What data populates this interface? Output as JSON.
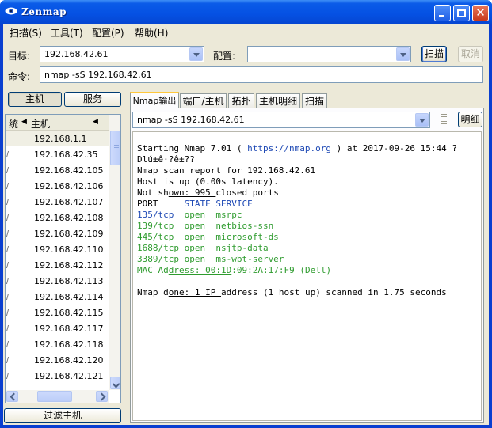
{
  "window": {
    "title": "Zenmap"
  },
  "menu": [
    {
      "label": "扫描(S)"
    },
    {
      "label": "工具(T)"
    },
    {
      "label": "配置(P)"
    },
    {
      "label": "帮助(H)"
    }
  ],
  "toolbar": {
    "target_label": "目标:",
    "target_value": "192.168.42.61",
    "profile_label": "配置:",
    "profile_value": "",
    "scan_button": "扫描",
    "cancel_button": "取消",
    "command_label": "命令:",
    "command_value": "nmap -sS 192.168.42.61"
  },
  "left_pane": {
    "hosts_button": "主机",
    "services_button": "服务",
    "col_os": "统",
    "col_host": "主机",
    "hosts": [
      "192.168.1.1",
      "192.168.42.35",
      "192.168.42.105",
      "192.168.42.106",
      "192.168.42.107",
      "192.168.42.108",
      "192.168.42.109",
      "192.168.42.110",
      "192.168.42.112",
      "192.168.42.113",
      "192.168.42.114",
      "192.168.42.115",
      "192.168.42.117",
      "192.168.42.118",
      "192.168.42.120",
      "192.168.42.121"
    ],
    "filter_button": "过滤主机"
  },
  "tabs": [
    {
      "label": "Nmap输出"
    },
    {
      "label": "端口/主机"
    },
    {
      "label": "拓扑"
    },
    {
      "label": "主机明细"
    },
    {
      "label": "扫描"
    }
  ],
  "output": {
    "command_value": "nmap -sS 192.168.42.61",
    "details_button": "明细",
    "lines": {
      "l1_a": "Starting Nmap 7.01 ( ",
      "l1_url": "https://nmap.org",
      "l1_b": " ) at 2017-09-26 15:44 ?",
      "l2": "Dlú±ê·?ê±??",
      "l3": "Nmap scan report for 192.168.42.61",
      "l4": "Host is up (0.00s latency).",
      "l5_a": "Not sh",
      "l5_b": "own: 995 ",
      "l5_c": "closed ports",
      "l6_a": "PORT     ",
      "l6_b": "STATE SERVICE",
      "p1_port": "135/tcp",
      "p1_rest": "  open  msrpc",
      "p2": "139/tcp  open  netbios-ssn",
      "p3": "445/tcp  open  microsoft-ds",
      "p4": "1688/tcp open  nsjtp-data",
      "p5": "3389/tcp open  ms-wbt-server",
      "mac_a": "MAC Ad",
      "mac_b": "dress: 00:1D",
      "mac_c": ":09:2A:17:F9 (Dell)",
      "done_a": "Nmap d",
      "done_b": "one: 1 IP ",
      "done_c": "address (1 host up) scanned in 1.75 seconds"
    }
  }
}
